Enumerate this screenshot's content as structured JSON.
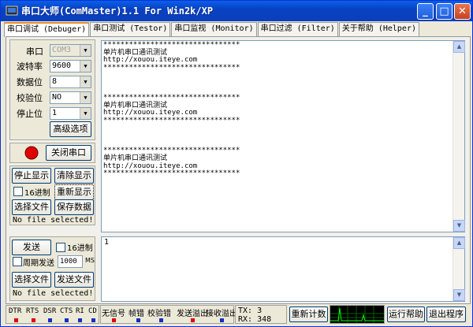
{
  "window": {
    "title": "串口大师(ComMaster)1.1 For Win2k/XP",
    "controls": {
      "minimize": "_",
      "maximize": "□",
      "close": "✕"
    }
  },
  "tabs": [
    {
      "label": "串口调试 (Debuger)",
      "active": true
    },
    {
      "label": "串口测试 (Testor)",
      "active": false
    },
    {
      "label": "串口监视 (Monitor)",
      "active": false
    },
    {
      "label": "串口过滤 (Filter)",
      "active": false
    },
    {
      "label": "关于帮助 (Helper)",
      "active": false
    }
  ],
  "settings": {
    "port": {
      "label": "串口",
      "value": "COM3"
    },
    "baud": {
      "label": "波特率",
      "value": "9600"
    },
    "databits": {
      "label": "数据位",
      "value": "8"
    },
    "parity": {
      "label": "校验位",
      "value": "NO"
    },
    "stopbits": {
      "label": "停止位",
      "value": "1"
    },
    "advanced_button": "高级选项"
  },
  "port_control": {
    "close_port_button": "关闭串口",
    "indicator_color": "#e00000"
  },
  "receive_controls": {
    "stop_display": "停止显示",
    "clear_display": "清除显示",
    "hex_label": "16进制",
    "redisplay": "重新显示",
    "select_file": "选择文件",
    "save_data": "保存数据",
    "file_status": "No file selected!"
  },
  "send_controls": {
    "send_button": "发送",
    "hex_label": "16进制",
    "periodic_label": "周期发送",
    "period_value": "1000",
    "period_unit": "MS",
    "select_file": "选择文件",
    "send_file": "发送文件",
    "file_status": "No file selected!"
  },
  "receive_text": "********************************\n单片机串口通讯测试\nhttp://xouou.iteye.com\n********************************\n\n\n\n********************************\n单片机串口通讯测试\nhttp://xouou.iteye.com\n********************************\n\n\n\n********************************\n单片机串口通讯测试\nhttp://xouou.iteye.com\n********************************",
  "send_text": "1",
  "statusbar": {
    "signals": [
      "DTR",
      "RTS",
      "DSR",
      "CTS",
      "RI",
      "CD"
    ],
    "signal_colors": [
      "#e00000",
      "#e00000",
      "#1030c0",
      "#1030c0",
      "#1030c0",
      "#1030c0"
    ],
    "errors": [
      "无信号",
      "帧错",
      "校验错",
      "发送溢出",
      "接收溢出"
    ],
    "error_colors": [
      "#e00000",
      "#1030c0",
      "#1030c0",
      "#e00000",
      "#1030c0"
    ],
    "tx_label": "TX: 3",
    "rx_label": "RX: 348",
    "reset_count": "重新计数",
    "help_button": "运行帮助",
    "exit_button": "退出程序"
  }
}
